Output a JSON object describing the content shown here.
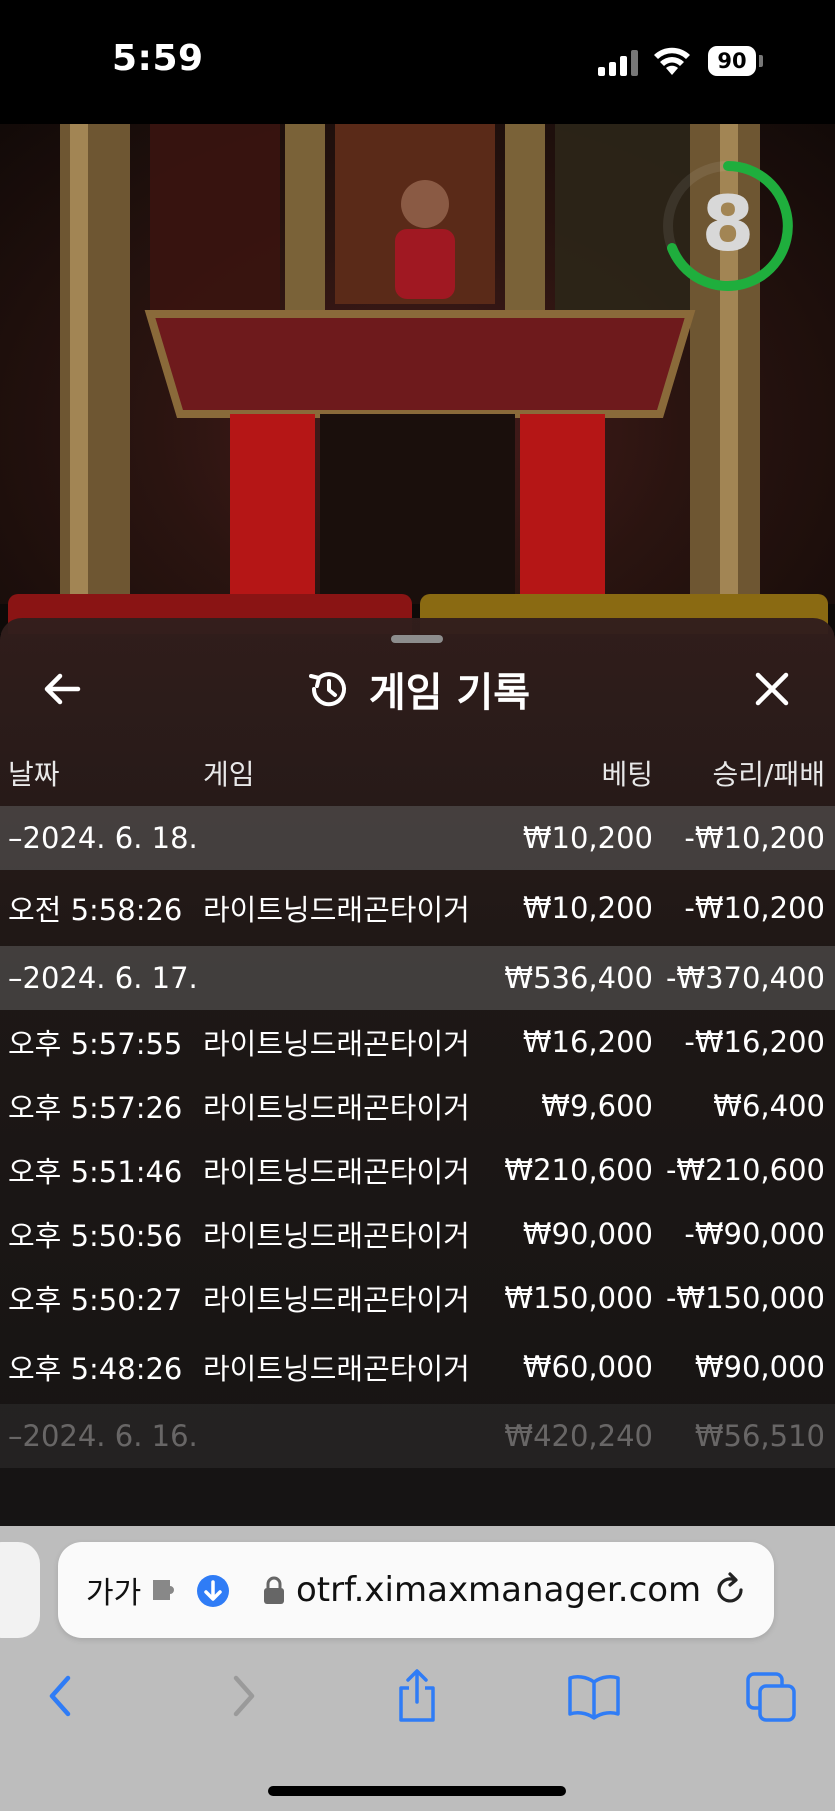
{
  "status_bar": {
    "time": "5:59",
    "battery": "90"
  },
  "video": {
    "countdown": "8"
  },
  "sheet": {
    "title": "게임 기록",
    "columns": {
      "date": "날짜",
      "game": "게임",
      "bet": "베팅",
      "win_loss": "승리/패배"
    },
    "groups": [
      {
        "date": "–2024. 6. 18.",
        "bet_total": "₩10,200",
        "win_total": "-₩10,200",
        "rows": [
          {
            "time": "오전 5:58:26",
            "game": "라이트닝드래곤타이거",
            "bet": "₩10,200",
            "win": "-₩10,200"
          }
        ]
      },
      {
        "date": "–2024. 6. 17.",
        "bet_total": "₩536,400",
        "win_total": "-₩370,400",
        "rows": [
          {
            "time": "오후 5:57:55",
            "game": "라이트닝드래곤타이거",
            "bet": "₩16,200",
            "win": "-₩16,200"
          },
          {
            "time": "오후 5:57:26",
            "game": "라이트닝드래곤타이거",
            "bet": "₩9,600",
            "win": "₩6,400"
          },
          {
            "time": "오후 5:51:46",
            "game": "라이트닝드래곤타이거",
            "bet": "₩210,600",
            "win": "-₩210,600"
          },
          {
            "time": "오후 5:50:56",
            "game": "라이트닝드래곤타이거",
            "bet": "₩90,000",
            "win": "-₩90,000"
          },
          {
            "time": "오후 5:50:27",
            "game": "라이트닝드래곤타이거",
            "bet": "₩150,000",
            "win": "-₩150,000"
          },
          {
            "time": "오후 5:48:26",
            "game": "라이트닝드래곤타이거",
            "bet": "₩60,000",
            "win": "₩90,000"
          }
        ]
      },
      {
        "date": "–2024. 6. 16.",
        "bet_total": "₩420,240",
        "win_total": "₩56,510",
        "rows": []
      }
    ]
  },
  "browser": {
    "aa_label": "가가",
    "url": "otrf.ximaxmanager.com",
    "accent": "#2f7cf6",
    "icons": [
      "back-icon",
      "forward-icon",
      "share-icon",
      "bookmarks-icon",
      "tabs-icon"
    ]
  }
}
